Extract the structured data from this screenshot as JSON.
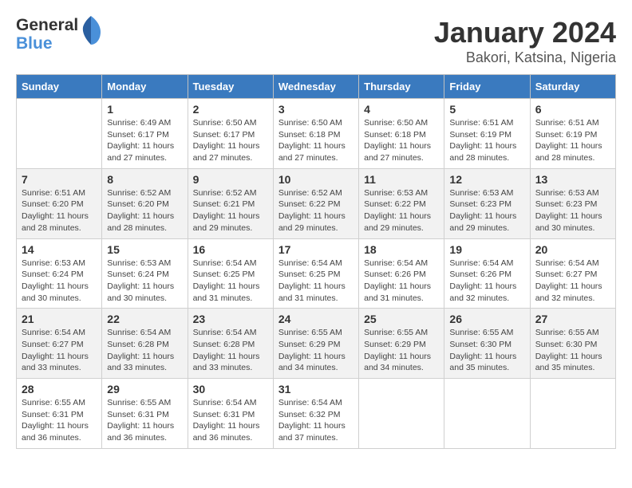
{
  "header": {
    "logo_general": "General",
    "logo_blue": "Blue",
    "title": "January 2024",
    "subtitle": "Bakori, Katsina, Nigeria"
  },
  "calendar": {
    "days_of_week": [
      "Sunday",
      "Monday",
      "Tuesday",
      "Wednesday",
      "Thursday",
      "Friday",
      "Saturday"
    ],
    "weeks": [
      [
        {
          "day": "",
          "sunrise": "",
          "sunset": "",
          "daylight": ""
        },
        {
          "day": "1",
          "sunrise": "Sunrise: 6:49 AM",
          "sunset": "Sunset: 6:17 PM",
          "daylight": "Daylight: 11 hours and 27 minutes."
        },
        {
          "day": "2",
          "sunrise": "Sunrise: 6:50 AM",
          "sunset": "Sunset: 6:17 PM",
          "daylight": "Daylight: 11 hours and 27 minutes."
        },
        {
          "day": "3",
          "sunrise": "Sunrise: 6:50 AM",
          "sunset": "Sunset: 6:18 PM",
          "daylight": "Daylight: 11 hours and 27 minutes."
        },
        {
          "day": "4",
          "sunrise": "Sunrise: 6:50 AM",
          "sunset": "Sunset: 6:18 PM",
          "daylight": "Daylight: 11 hours and 27 minutes."
        },
        {
          "day": "5",
          "sunrise": "Sunrise: 6:51 AM",
          "sunset": "Sunset: 6:19 PM",
          "daylight": "Daylight: 11 hours and 28 minutes."
        },
        {
          "day": "6",
          "sunrise": "Sunrise: 6:51 AM",
          "sunset": "Sunset: 6:19 PM",
          "daylight": "Daylight: 11 hours and 28 minutes."
        }
      ],
      [
        {
          "day": "7",
          "sunrise": "Sunrise: 6:51 AM",
          "sunset": "Sunset: 6:20 PM",
          "daylight": "Daylight: 11 hours and 28 minutes."
        },
        {
          "day": "8",
          "sunrise": "Sunrise: 6:52 AM",
          "sunset": "Sunset: 6:20 PM",
          "daylight": "Daylight: 11 hours and 28 minutes."
        },
        {
          "day": "9",
          "sunrise": "Sunrise: 6:52 AM",
          "sunset": "Sunset: 6:21 PM",
          "daylight": "Daylight: 11 hours and 29 minutes."
        },
        {
          "day": "10",
          "sunrise": "Sunrise: 6:52 AM",
          "sunset": "Sunset: 6:22 PM",
          "daylight": "Daylight: 11 hours and 29 minutes."
        },
        {
          "day": "11",
          "sunrise": "Sunrise: 6:53 AM",
          "sunset": "Sunset: 6:22 PM",
          "daylight": "Daylight: 11 hours and 29 minutes."
        },
        {
          "day": "12",
          "sunrise": "Sunrise: 6:53 AM",
          "sunset": "Sunset: 6:23 PM",
          "daylight": "Daylight: 11 hours and 29 minutes."
        },
        {
          "day": "13",
          "sunrise": "Sunrise: 6:53 AM",
          "sunset": "Sunset: 6:23 PM",
          "daylight": "Daylight: 11 hours and 30 minutes."
        }
      ],
      [
        {
          "day": "14",
          "sunrise": "Sunrise: 6:53 AM",
          "sunset": "Sunset: 6:24 PM",
          "daylight": "Daylight: 11 hours and 30 minutes."
        },
        {
          "day": "15",
          "sunrise": "Sunrise: 6:53 AM",
          "sunset": "Sunset: 6:24 PM",
          "daylight": "Daylight: 11 hours and 30 minutes."
        },
        {
          "day": "16",
          "sunrise": "Sunrise: 6:54 AM",
          "sunset": "Sunset: 6:25 PM",
          "daylight": "Daylight: 11 hours and 31 minutes."
        },
        {
          "day": "17",
          "sunrise": "Sunrise: 6:54 AM",
          "sunset": "Sunset: 6:25 PM",
          "daylight": "Daylight: 11 hours and 31 minutes."
        },
        {
          "day": "18",
          "sunrise": "Sunrise: 6:54 AM",
          "sunset": "Sunset: 6:26 PM",
          "daylight": "Daylight: 11 hours and 31 minutes."
        },
        {
          "day": "19",
          "sunrise": "Sunrise: 6:54 AM",
          "sunset": "Sunset: 6:26 PM",
          "daylight": "Daylight: 11 hours and 32 minutes."
        },
        {
          "day": "20",
          "sunrise": "Sunrise: 6:54 AM",
          "sunset": "Sunset: 6:27 PM",
          "daylight": "Daylight: 11 hours and 32 minutes."
        }
      ],
      [
        {
          "day": "21",
          "sunrise": "Sunrise: 6:54 AM",
          "sunset": "Sunset: 6:27 PM",
          "daylight": "Daylight: 11 hours and 33 minutes."
        },
        {
          "day": "22",
          "sunrise": "Sunrise: 6:54 AM",
          "sunset": "Sunset: 6:28 PM",
          "daylight": "Daylight: 11 hours and 33 minutes."
        },
        {
          "day": "23",
          "sunrise": "Sunrise: 6:54 AM",
          "sunset": "Sunset: 6:28 PM",
          "daylight": "Daylight: 11 hours and 33 minutes."
        },
        {
          "day": "24",
          "sunrise": "Sunrise: 6:55 AM",
          "sunset": "Sunset: 6:29 PM",
          "daylight": "Daylight: 11 hours and 34 minutes."
        },
        {
          "day": "25",
          "sunrise": "Sunrise: 6:55 AM",
          "sunset": "Sunset: 6:29 PM",
          "daylight": "Daylight: 11 hours and 34 minutes."
        },
        {
          "day": "26",
          "sunrise": "Sunrise: 6:55 AM",
          "sunset": "Sunset: 6:30 PM",
          "daylight": "Daylight: 11 hours and 35 minutes."
        },
        {
          "day": "27",
          "sunrise": "Sunrise: 6:55 AM",
          "sunset": "Sunset: 6:30 PM",
          "daylight": "Daylight: 11 hours and 35 minutes."
        }
      ],
      [
        {
          "day": "28",
          "sunrise": "Sunrise: 6:55 AM",
          "sunset": "Sunset: 6:31 PM",
          "daylight": "Daylight: 11 hours and 36 minutes."
        },
        {
          "day": "29",
          "sunrise": "Sunrise: 6:55 AM",
          "sunset": "Sunset: 6:31 PM",
          "daylight": "Daylight: 11 hours and 36 minutes."
        },
        {
          "day": "30",
          "sunrise": "Sunrise: 6:54 AM",
          "sunset": "Sunset: 6:31 PM",
          "daylight": "Daylight: 11 hours and 36 minutes."
        },
        {
          "day": "31",
          "sunrise": "Sunrise: 6:54 AM",
          "sunset": "Sunset: 6:32 PM",
          "daylight": "Daylight: 11 hours and 37 minutes."
        },
        {
          "day": "",
          "sunrise": "",
          "sunset": "",
          "daylight": ""
        },
        {
          "day": "",
          "sunrise": "",
          "sunset": "",
          "daylight": ""
        },
        {
          "day": "",
          "sunrise": "",
          "sunset": "",
          "daylight": ""
        }
      ]
    ]
  }
}
